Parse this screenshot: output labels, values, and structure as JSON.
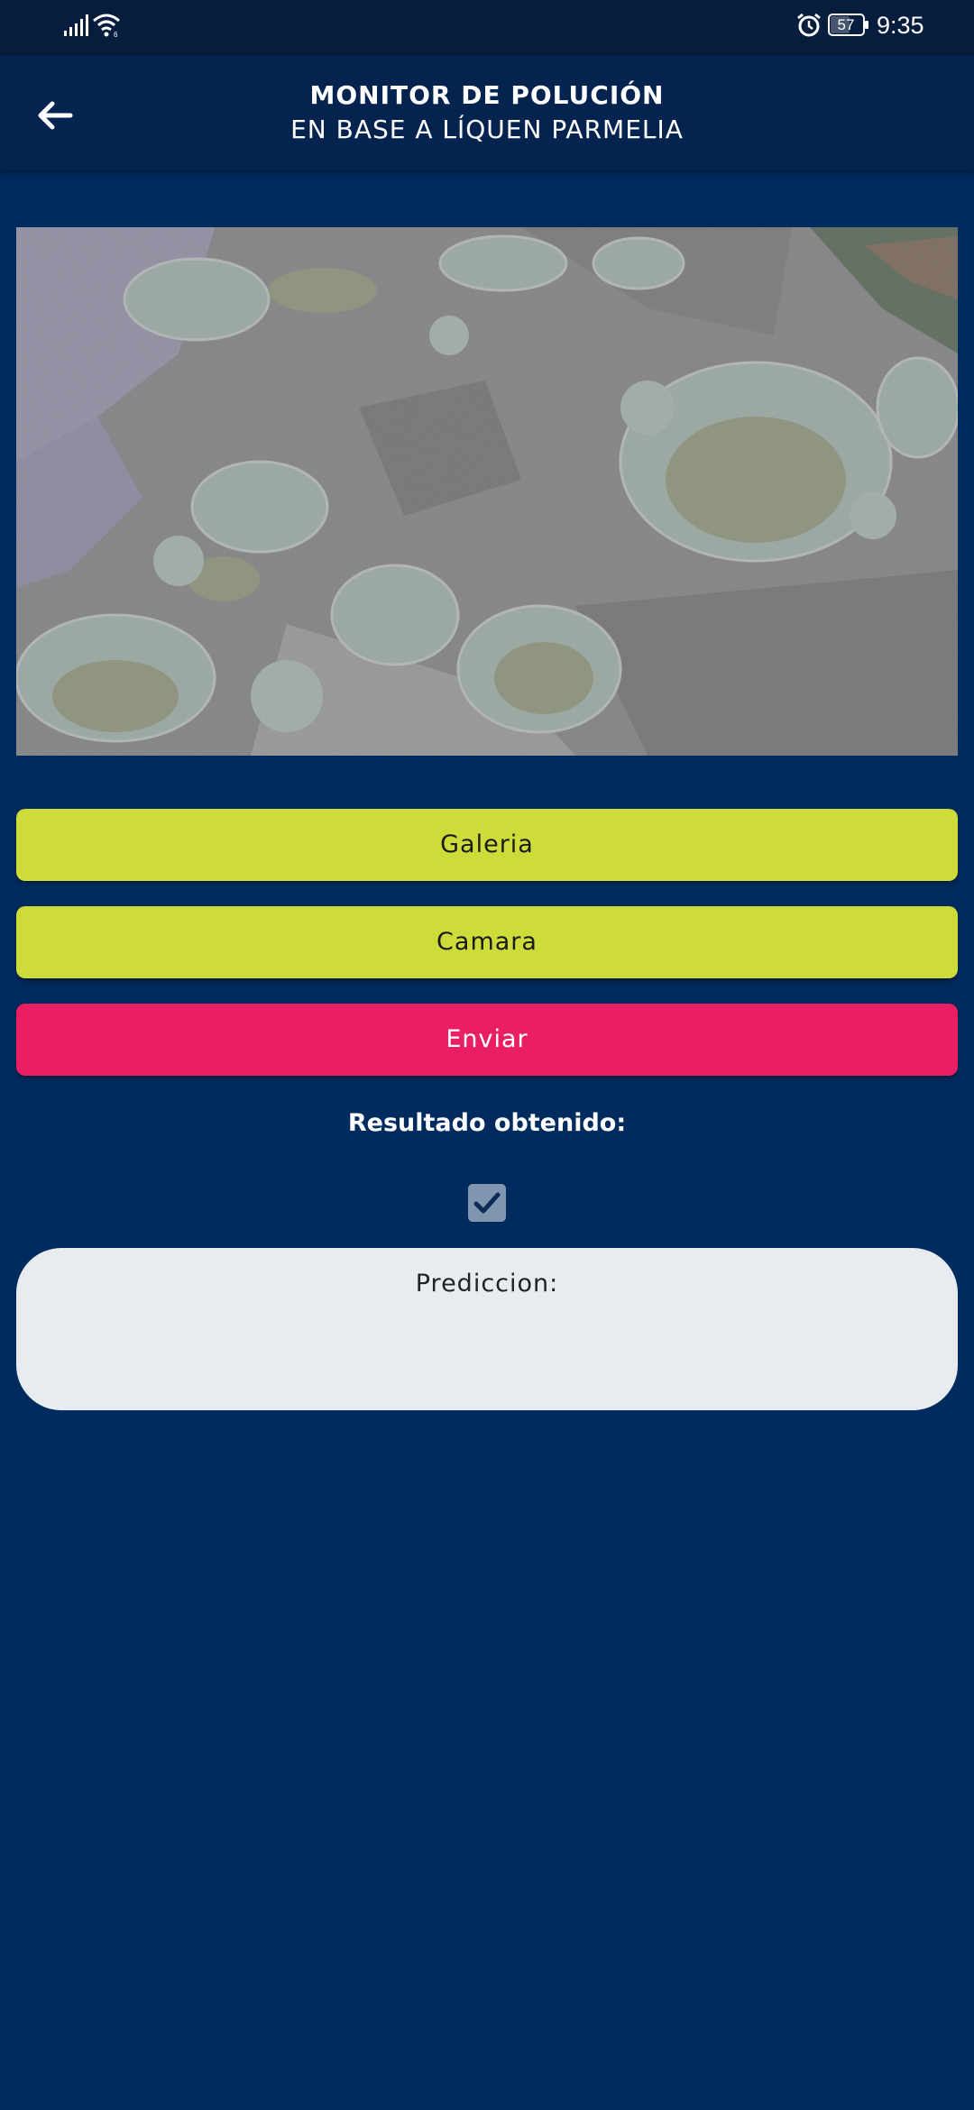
{
  "status_bar": {
    "battery_level": "57",
    "time": "9:35",
    "icons": [
      "signal-icon",
      "wifi-icon",
      "alarm-icon",
      "battery-icon"
    ]
  },
  "app_bar": {
    "title": "MONITOR DE POLUCIÓN",
    "subtitle": "EN BASE A LÍQUEN PARMELIA",
    "back_icon": "arrow-back-icon"
  },
  "photo": {
    "subject": "lichen-on-rock-photo"
  },
  "actions": {
    "gallery_label": "Galeria",
    "camera_label": "Camara",
    "send_label": "Enviar"
  },
  "result": {
    "label": "Resultado obtenido:",
    "checked": true
  },
  "prediction": {
    "label": "Prediccion:",
    "value": ""
  },
  "colors": {
    "background": "#002b5e",
    "app_bar": "#04244f",
    "status_bar": "#061d3d",
    "lime_button": "#cddc39",
    "pink_button": "#e91e63",
    "card": "#e8ebf0",
    "checkbox": "#7f95b0"
  }
}
